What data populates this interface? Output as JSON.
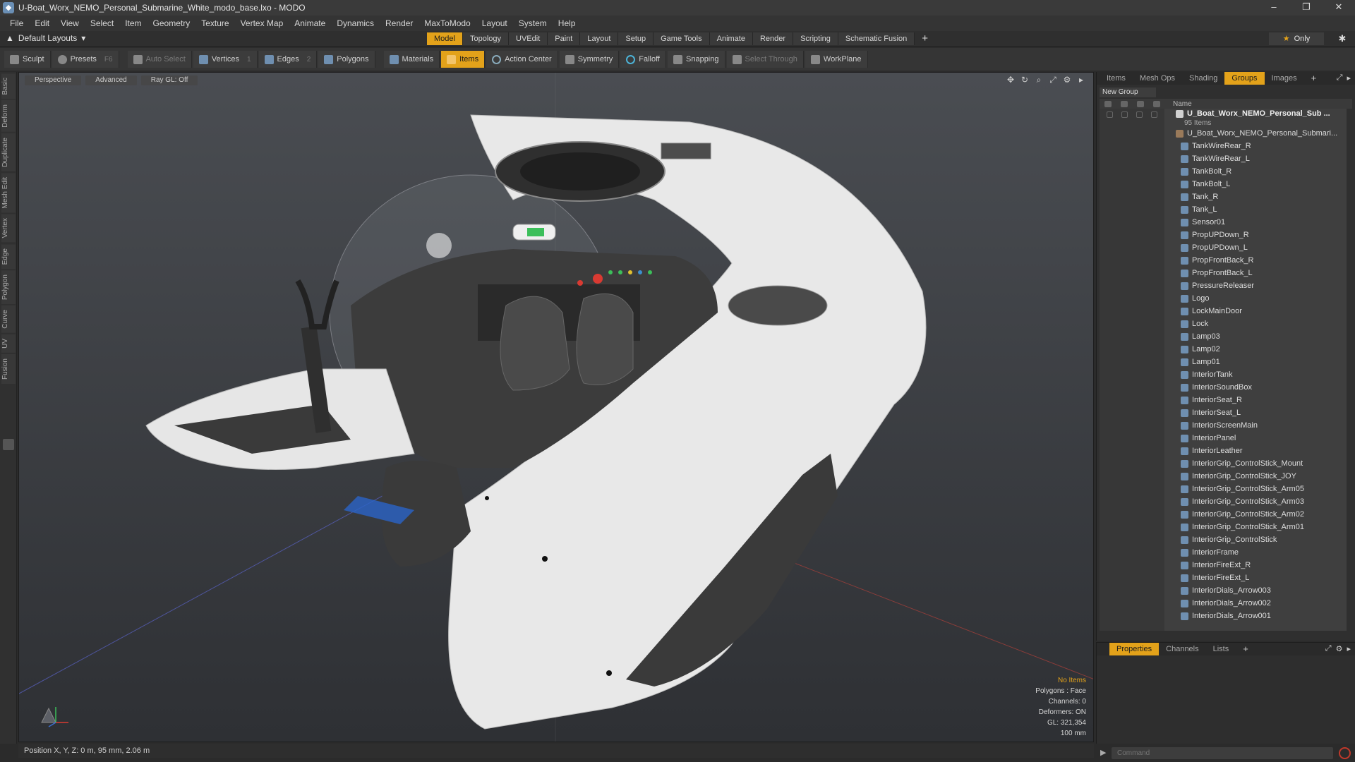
{
  "window": {
    "title": "U-Boat_Worx_NEMO_Personal_Submarine_White_modo_base.lxo - MODO",
    "controls": [
      "–",
      "❐",
      "✕"
    ]
  },
  "menu": [
    "File",
    "Edit",
    "View",
    "Select",
    "Item",
    "Geometry",
    "Texture",
    "Vertex Map",
    "Animate",
    "Dynamics",
    "Render",
    "MaxToModo",
    "Layout",
    "System",
    "Help"
  ],
  "layout": {
    "selector": "Default Layouts",
    "tabs": [
      "Model",
      "Topology",
      "UVEdit",
      "Paint",
      "Layout",
      "Setup",
      "Game Tools",
      "Animate",
      "Render",
      "Scripting",
      "Schematic Fusion"
    ],
    "active_tab": "Model",
    "only_label": "Only"
  },
  "toolbar": {
    "sculpt": "Sculpt",
    "presets": "Presets",
    "presets_key": "F6",
    "auto_select": "Auto Select",
    "vertices": "Vertices",
    "vertices_num": "1",
    "edges": "Edges",
    "edges_num": "2",
    "polygons": "Polygons",
    "materials": "Materials",
    "items": "Items",
    "action_center": "Action Center",
    "symmetry": "Symmetry",
    "falloff": "Falloff",
    "snapping": "Snapping",
    "select_through": "Select Through",
    "workplane": "WorkPlane"
  },
  "left_tabs": [
    "Basic",
    "Deform",
    "Duplicate",
    "Mesh Edit",
    "Vertex",
    "Edge",
    "Polygon",
    "Curve",
    "UV",
    "Fusion"
  ],
  "viewport": {
    "perspective": "Perspective",
    "advanced": "Advanced",
    "raygl": "Ray GL: Off",
    "info": {
      "items": "No Items",
      "polygons": "Polygons : Face",
      "channels": "Channels: 0",
      "deformers": "Deformers: ON",
      "gl": "GL: 321,354",
      "scale": "100 mm"
    },
    "colors": {
      "accent": "#e3a21a"
    }
  },
  "status": {
    "position": "Position X, Y, Z:  0 m, 95 mm, 2.06 m"
  },
  "right_panel": {
    "tabs": [
      "Items",
      "Mesh Ops",
      "Shading",
      "Groups",
      "Images"
    ],
    "active_tab": "Groups",
    "new_group": "New Group",
    "name_header": "Name",
    "root": "U_Boat_Worx_NEMO_Personal_Sub ...",
    "root_count": "95 Items",
    "sub": "U_Boat_Worx_NEMO_Personal_Submari...",
    "items": [
      "TankWireRear_R",
      "TankWireRear_L",
      "TankBolt_R",
      "TankBolt_L",
      "Tank_R",
      "Tank_L",
      "Sensor01",
      "PropUPDown_R",
      "PropUPDown_L",
      "PropFrontBack_R",
      "PropFrontBack_L",
      "PressureReleaser",
      "Logo",
      "LockMainDoor",
      "Lock",
      "Lamp03",
      "Lamp02",
      "Lamp01",
      "InteriorTank",
      "InteriorSoundBox",
      "InteriorSeat_R",
      "InteriorSeat_L",
      "InteriorScreenMain",
      "InteriorPanel",
      "InteriorLeather",
      "InteriorGrip_ControlStick_Mount",
      "InteriorGrip_ControlStick_JOY",
      "InteriorGrip_ControlStick_Arm05",
      "InteriorGrip_ControlStick_Arm03",
      "InteriorGrip_ControlStick_Arm02",
      "InteriorGrip_ControlStick_Arm01",
      "InteriorGrip_ControlStick",
      "InteriorFrame",
      "InteriorFireExt_R",
      "InteriorFireExt_L",
      "InteriorDials_Arrow003",
      "InteriorDials_Arrow002",
      "InteriorDials_Arrow001"
    ]
  },
  "properties_panel": {
    "tabs": [
      "Properties",
      "Channels",
      "Lists"
    ],
    "active_tab": "Properties"
  },
  "command": {
    "placeholder": "Command"
  }
}
